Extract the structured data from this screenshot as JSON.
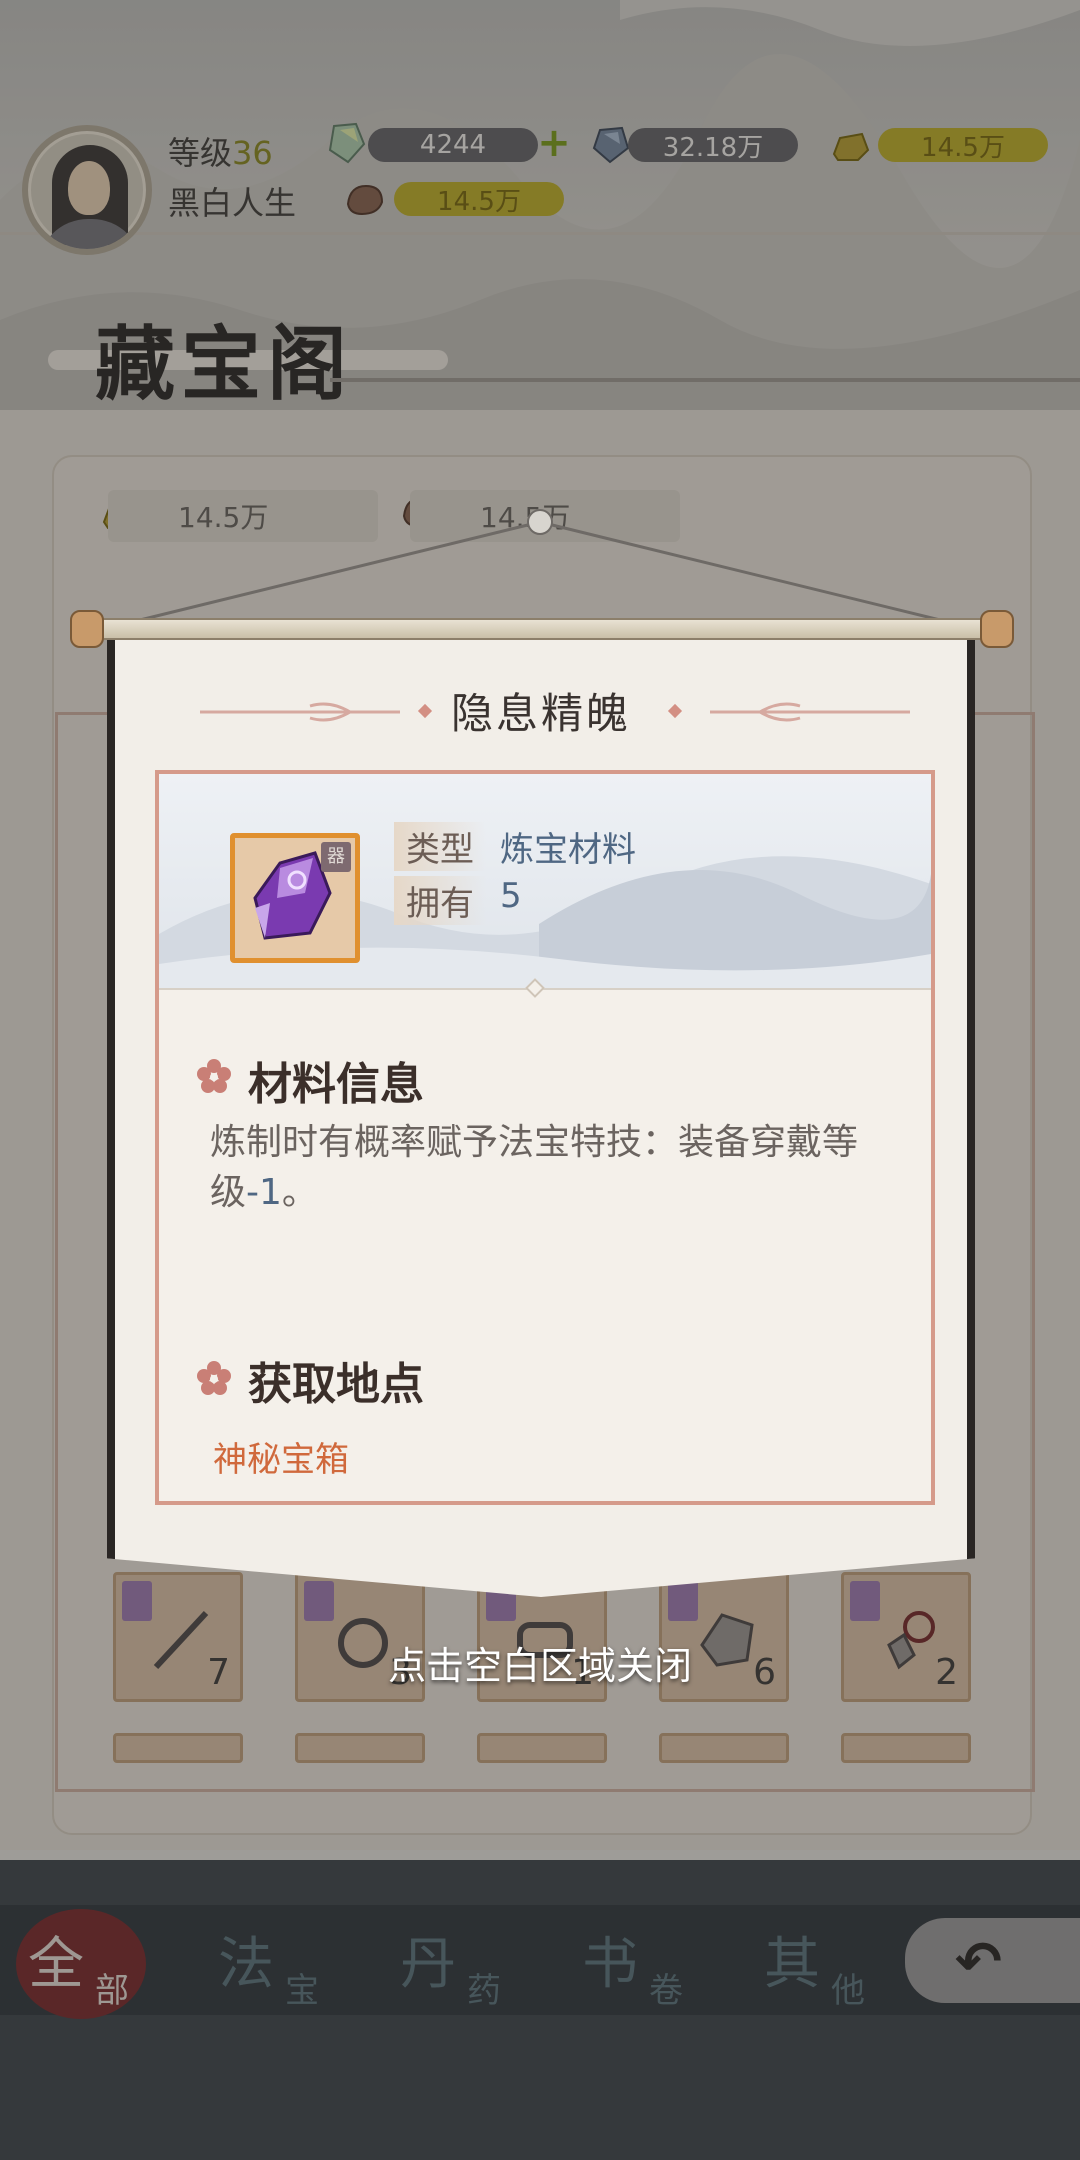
{
  "header": {
    "level_label": "等级",
    "level_value": "36",
    "player_name": "黑白人生",
    "resources": {
      "gem": "4244",
      "crystal": "32.18万",
      "gold": "14.5万",
      "ore": "14.5万"
    }
  },
  "page": {
    "title": "藏宝阁",
    "costs": [
      "14.5万",
      "14.5万"
    ]
  },
  "inventory": {
    "counts": [
      "7",
      "3",
      "1",
      "6",
      "2"
    ]
  },
  "modal": {
    "title": "隐息精魄",
    "item_tag": "器",
    "type_label": "类型",
    "type_value": "炼宝材料",
    "own_label": "拥有",
    "own_value": "5",
    "material_section": "材料信息",
    "desc_main": "炼制时有概率赋予法宝特技：装备穿戴等级",
    "desc_value": "-1",
    "desc_end": "。",
    "source_section": "获取地点",
    "source_value": "神秘宝箱",
    "close_hint": "点击空白区域关闭"
  },
  "nav": {
    "tabs": [
      {
        "big": "全",
        "small": "部"
      },
      {
        "big": "法",
        "small": "宝"
      },
      {
        "big": "丹",
        "small": "药"
      },
      {
        "big": "书",
        "small": "卷"
      },
      {
        "big": "其",
        "small": "他"
      }
    ],
    "active_index": 0
  },
  "colors": {
    "accent_red": "#d0693c",
    "value_blue": "#4f6783",
    "frame_pink": "#d59a8a"
  }
}
